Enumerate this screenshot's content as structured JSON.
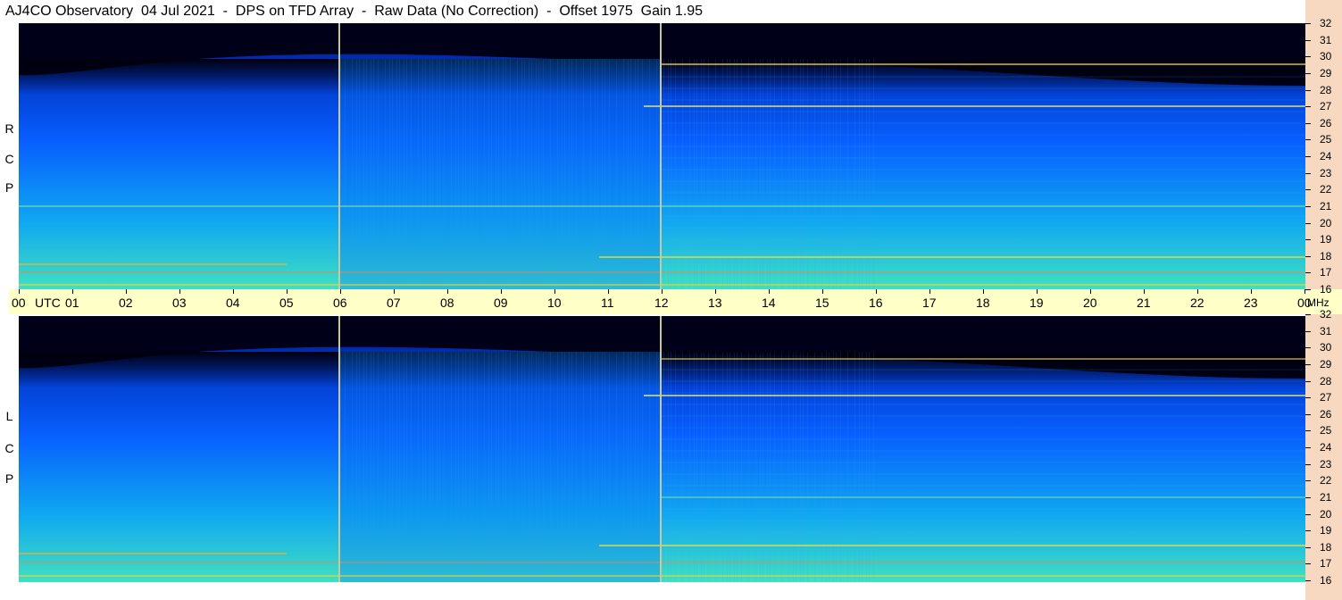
{
  "title": "AJ4CO Observatory  04 Jul 2021  -  DPS on TFD Array  -  Raw Data (No Correction)  -  Offset 1975  Gain 1.95",
  "panels": [
    {
      "id": "rcp",
      "label_letters": [
        "R",
        "C",
        "P"
      ]
    },
    {
      "id": "lcp",
      "label_letters": [
        "L",
        "C",
        "P"
      ]
    }
  ],
  "time_axis": {
    "unit": "UTC",
    "ticks": [
      "00",
      "01",
      "02",
      "03",
      "04",
      "05",
      "06",
      "07",
      "08",
      "09",
      "10",
      "11",
      "12",
      "13",
      "14",
      "15",
      "16",
      "17",
      "18",
      "19",
      "20",
      "21",
      "22",
      "23",
      "00"
    ]
  },
  "freq_axis": {
    "unit": "MHz",
    "ticks": [
      "32",
      "31",
      "30",
      "29",
      "28",
      "27",
      "26",
      "25",
      "24",
      "23",
      "22",
      "21",
      "20",
      "19",
      "18",
      "17",
      "16"
    ]
  },
  "colors": {
    "background": "#ffffff",
    "time_axis_bg": "#ffffc8",
    "right_strip": "#f7d9c2",
    "marker_line": "#c8c8a0"
  }
}
